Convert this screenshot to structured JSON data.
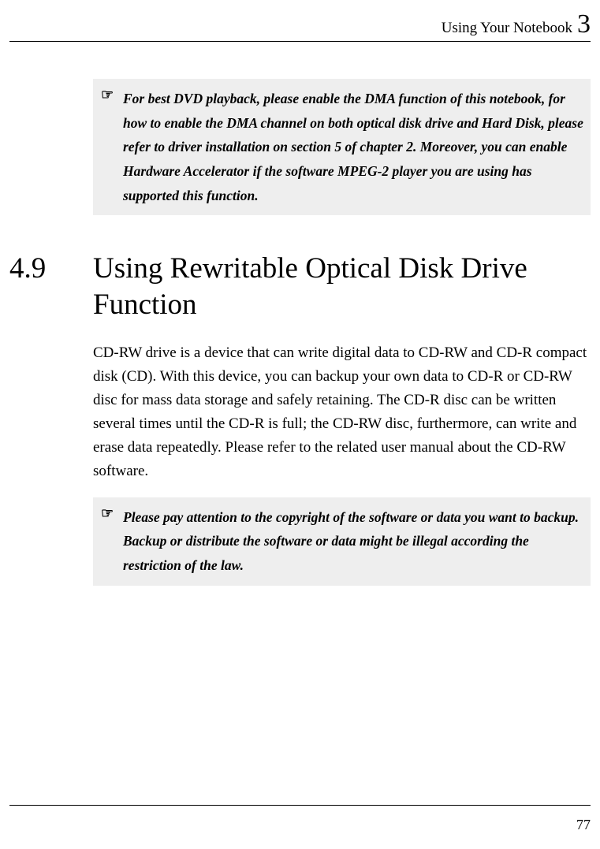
{
  "header": {
    "title": "Using Your Notebook",
    "chapter": "3"
  },
  "note1": {
    "icon": "☞",
    "text": "For best DVD playback, please enable the DMA function of this notebook, for how to enable the DMA channel on both optical disk drive and Hard Disk, please refer to driver installation on section 5 of chapter 2. Moreover, you can enable Hardware Accelerator if the software MPEG-2 player you are using has supported this function."
  },
  "section": {
    "number": "4.9",
    "title": "Using Rewritable Optical Disk Drive Function"
  },
  "body": "CD-RW drive is a device that can write digital data to CD-RW and CD-R compact disk (CD). With this device, you can backup your own data to CD-R or CD-RW disc for mass data storage and safely retaining. The CD-R disc can be written several times until the CD-R is full; the CD-RW disc, furthermore, can write and erase data repeatedly. Please refer to the related user manual about the CD-RW software.",
  "note2": {
    "icon": "☞",
    "text": "Please pay attention to the copyright of the software or data you want to backup. Backup or distribute the software or data might be illegal according the restriction of the law."
  },
  "footer": {
    "page": "77"
  }
}
